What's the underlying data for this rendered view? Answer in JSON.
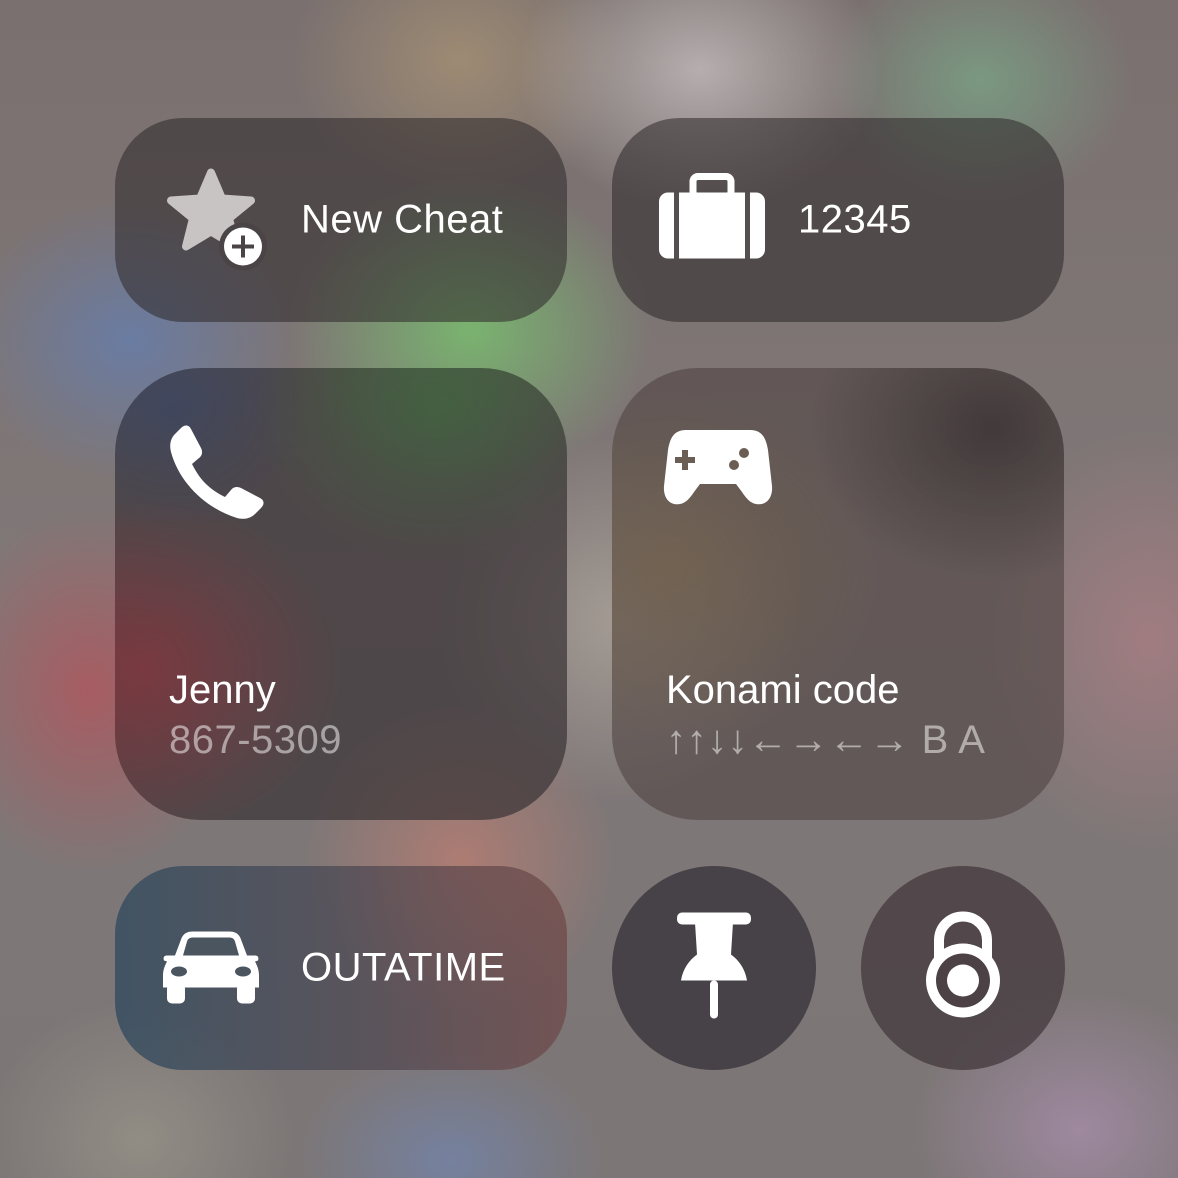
{
  "tiles": {
    "new_cheat": {
      "label": "New Cheat",
      "icon": "star-add-icon"
    },
    "code": {
      "label": "12345",
      "icon": "briefcase-icon"
    },
    "jenny": {
      "title": "Jenny",
      "subtitle": "867-5309",
      "icon": "phone-icon"
    },
    "konami": {
      "title": "Konami code",
      "subtitle": "↑↑↓↓←→←→ B A",
      "icon": "gamepad-icon"
    },
    "outatime": {
      "label": "OUTATIME",
      "icon": "car-icon"
    },
    "pin": {
      "icon": "pushpin-icon"
    },
    "lock": {
      "icon": "padlock-icon"
    }
  },
  "colors": {
    "tile_fill": "#2d282a",
    "text": "#ffffff",
    "subtext": "#ffffff80"
  }
}
